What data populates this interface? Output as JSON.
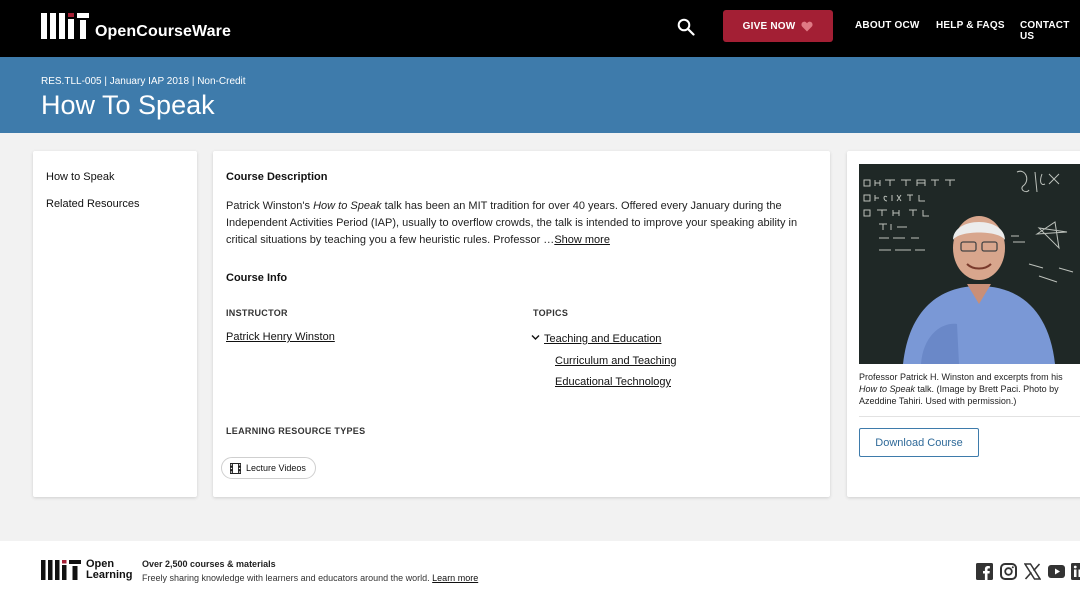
{
  "header": {
    "brand": "OpenCourseWare",
    "give_label": "GIVE NOW",
    "nav": [
      "ABOUT OCW",
      "HELP & FAQS",
      "CONTACT US"
    ]
  },
  "banner": {
    "meta": "RES.TLL-005 | January IAP 2018 | Non-Credit",
    "title": "How To Speak"
  },
  "sidebar": {
    "items": [
      {
        "label": "How to Speak"
      },
      {
        "label": "Related Resources"
      }
    ]
  },
  "main": {
    "description_heading": "Course Description",
    "description_intro": "Patrick Winston's ",
    "description_em": "How to Speak",
    "description_body": " talk has been an MIT tradition for over 40 years. Offered every January during the Independent Activities Period (IAP), usually to overflow crowds, the talk is intended to improve your speaking ability in critical situations by teaching you a few heuristic rules. Professor …",
    "show_more": "Show more",
    "course_info_heading": "Course Info",
    "instructor_label": "INSTRUCTOR",
    "instructor": "Patrick Henry Winston",
    "topics_label": "TOPICS",
    "topic_main": "Teaching and Education",
    "topic_sub1": "Curriculum and Teaching",
    "topic_sub2": "Educational Technology",
    "lrt_label": "LEARNING RESOURCE TYPES",
    "lrt_item": "Lecture Videos"
  },
  "side": {
    "image_alt": "Professor Patrick H. Winston at a chalkboard",
    "caption_pre": "Professor Patrick H. Winston and excerpts from his ",
    "caption_em": "How to Speak",
    "caption_post": " talk. (Image by Brett Paci. Photo by Azeddine Tahiri. Used with permission.)",
    "download_label": "Download Course"
  },
  "footer": {
    "ol_line1": "Open",
    "ol_line2": "Learning",
    "tagline_strong": "Over 2,500 courses & materials",
    "tagline": "Freely sharing knowledge with learners and educators around the world. ",
    "learn_more": "Learn more"
  },
  "colors": {
    "header_bg": "#000000",
    "banner_bg": "#3e7bab",
    "give_bg": "#a31f34",
    "page_bg": "#f2f2f2"
  },
  "icons": [
    "mit-logo-icon",
    "search-icon",
    "heart-icon",
    "chevron-down-icon",
    "film-icon",
    "open-learning-logo-icon",
    "facebook-icon",
    "instagram-icon",
    "x-icon",
    "youtube-icon",
    "linkedin-icon"
  ]
}
